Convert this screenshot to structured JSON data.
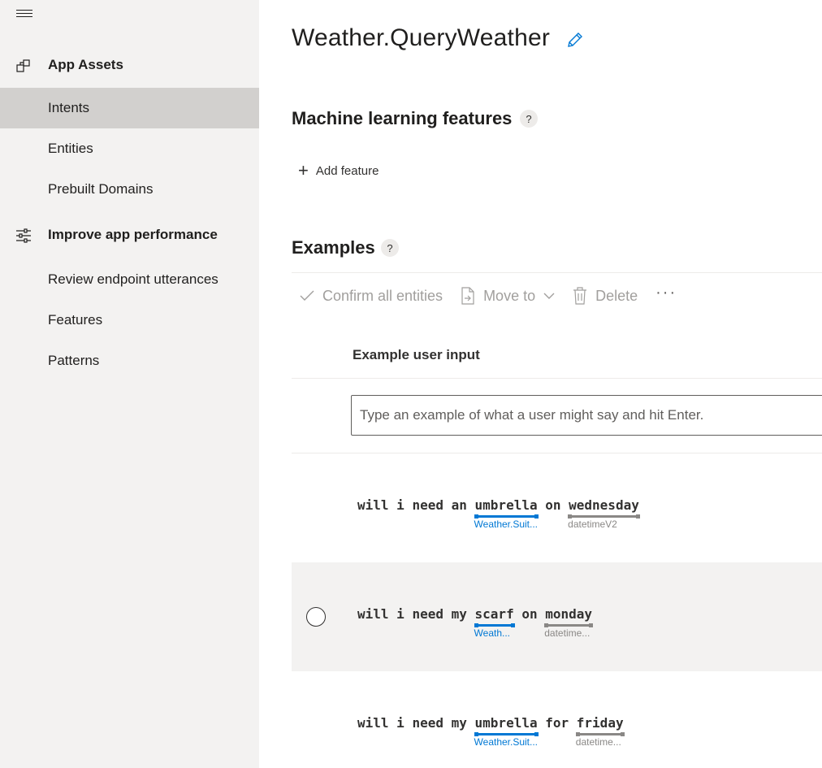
{
  "sidebar": {
    "sections": [
      {
        "label": "App Assets",
        "icon": "app-assets-icon",
        "items": [
          {
            "label": "Intents",
            "active": true
          },
          {
            "label": "Entities"
          },
          {
            "label": "Prebuilt Domains"
          }
        ]
      },
      {
        "label": "Improve app performance",
        "icon": "sliders-icon",
        "items": [
          {
            "label": "Review endpoint utterances"
          },
          {
            "label": "Features"
          },
          {
            "label": "Patterns"
          }
        ]
      }
    ]
  },
  "intent": {
    "title": "Weather.QueryWeather"
  },
  "ml_features": {
    "title": "Machine learning features",
    "help": "?",
    "add_label": "Add feature"
  },
  "examples": {
    "title": "Examples",
    "help": "?",
    "toolbar": {
      "confirm_label": "Confirm all entities",
      "move_label": "Move to",
      "delete_label": "Delete",
      "more_label": "···"
    },
    "column_header": "Example user input",
    "input_placeholder": "Type an example of what a user might say and hit Enter.",
    "utterances": [
      {
        "tokens": [
          {
            "text": "will"
          },
          {
            "text": "i"
          },
          {
            "text": "need"
          },
          {
            "text": "an"
          },
          {
            "text": "umbrella",
            "entity": "Weather.Suit...",
            "kind": "ml"
          },
          {
            "text": "on"
          },
          {
            "text": "wednesday",
            "entity": "datetimeV2",
            "kind": "pb"
          }
        ]
      },
      {
        "tokens": [
          {
            "text": "will"
          },
          {
            "text": "i"
          },
          {
            "text": "need"
          },
          {
            "text": "my"
          },
          {
            "text": "scarf",
            "entity": "Weath...",
            "kind": "ml"
          },
          {
            "text": "on"
          },
          {
            "text": "monday",
            "entity": "datetime...",
            "kind": "pb"
          }
        ]
      },
      {
        "tokens": [
          {
            "text": "will"
          },
          {
            "text": "i"
          },
          {
            "text": "need"
          },
          {
            "text": "my"
          },
          {
            "text": "umbrella",
            "entity": "Weather.Suit...",
            "kind": "ml"
          },
          {
            "text": "for"
          },
          {
            "text": "friday",
            "entity": "datetime...",
            "kind": "pb"
          }
        ]
      }
    ]
  },
  "colors": {
    "accent": "#0078d4",
    "prebuilt_entity": "#8a8886",
    "sidebar_bg": "#f3f2f1",
    "active_item_bg": "#d2d0ce"
  }
}
